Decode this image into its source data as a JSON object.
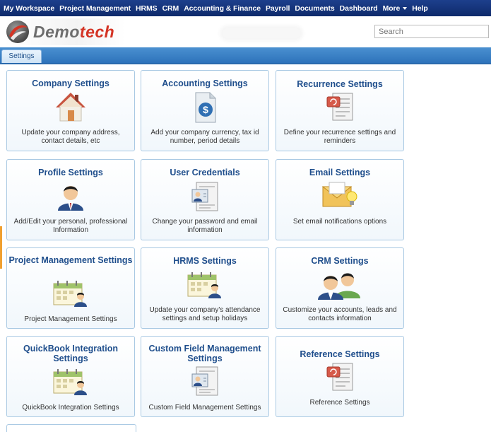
{
  "nav": {
    "items": [
      "My Workspace",
      "Project Management",
      "HRMS",
      "CRM",
      "Accounting & Finance",
      "Payroll",
      "Documents",
      "Dashboard",
      "More",
      "Help"
    ]
  },
  "header": {
    "logo_prefix": "Demo",
    "logo_suffix": "tech",
    "search_placeholder": "Search"
  },
  "tabs": {
    "active": "Settings"
  },
  "colors": {
    "nav_bg": "#1d3f8c",
    "tab_bar": "#3a80c6",
    "card_title": "#1f4e8c",
    "card_border": "#a9c9e3",
    "logo_red": "#d43425"
  },
  "cards": [
    {
      "title": "Company Settings",
      "desc": "Update your company address, contact details, etc",
      "icon": "house-icon"
    },
    {
      "title": "Accounting Settings",
      "desc": "Add your company currency, tax id number, period details",
      "icon": "dollar-document-icon"
    },
    {
      "title": "Recurrence Settings",
      "desc": "Define your recurrence settings and reminders",
      "icon": "recurrence-document-icon"
    },
    {
      "title": "Profile Settings",
      "desc": "Add/Edit your personal, professional Information",
      "icon": "user-profile-icon"
    },
    {
      "title": "User Credentials",
      "desc": "Change your password and email information",
      "icon": "credential-card-icon"
    },
    {
      "title": "Email Settings",
      "desc": "Set email notifications options",
      "icon": "email-bulb-icon"
    },
    {
      "title": "Project Management Settings",
      "desc": "Project Management Settings",
      "icon": "calendar-user-icon"
    },
    {
      "title": "HRMS Settings",
      "desc": "Update your company's attendance settings and setup holidays",
      "icon": "calendar-user-icon"
    },
    {
      "title": "CRM Settings",
      "desc": "Customize your accounts, leads and contacts information",
      "icon": "users-group-icon"
    },
    {
      "title": "QuickBook Integration Settings",
      "desc": "QuickBook Integration Settings",
      "icon": "calendar-user-icon"
    },
    {
      "title": "Custom Field Management Settings",
      "desc": "Custom Field Management Settings",
      "icon": "field-document-icon"
    },
    {
      "title": "Reference Settings",
      "desc": "Reference Settings",
      "icon": "reference-document-icon"
    }
  ]
}
